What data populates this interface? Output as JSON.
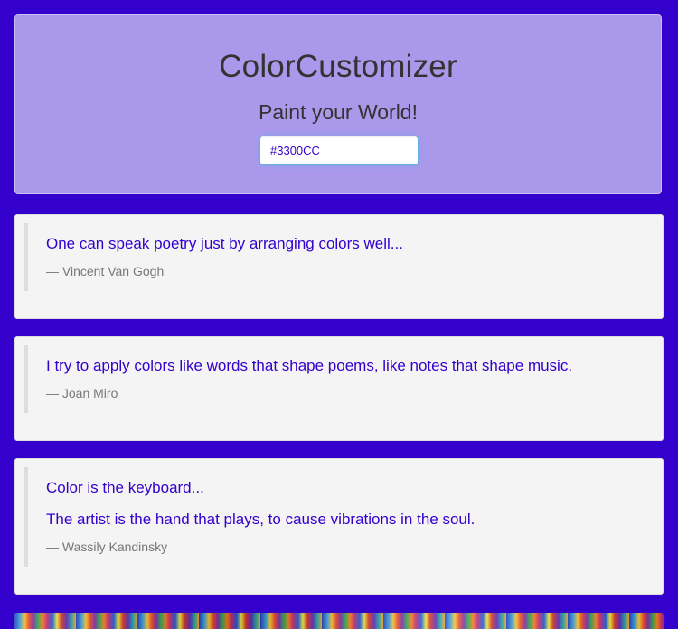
{
  "header": {
    "title": "ColorCustomizer",
    "subtitle": "Paint your World!"
  },
  "color_input": {
    "value": "#3300CC"
  },
  "colors": {
    "background": "#3300CC",
    "hero_background": "#AA99EB",
    "card_background": "#F4F4F4",
    "quote_text": "#3300CC",
    "author_text": "#777777"
  },
  "quotes": [
    {
      "lines": [
        "One can speak poetry just by arranging colors well..."
      ],
      "author": "— Vincent Van Gogh"
    },
    {
      "lines": [
        "I try to apply colors like words that shape poems, like notes that shape music."
      ],
      "author": "— Joan Miro"
    },
    {
      "lines": [
        "Color is the keyboard...",
        "The artist is the hand that plays, to cause vibrations in the soul."
      ],
      "author": "— Wassily Kandinsky"
    }
  ]
}
